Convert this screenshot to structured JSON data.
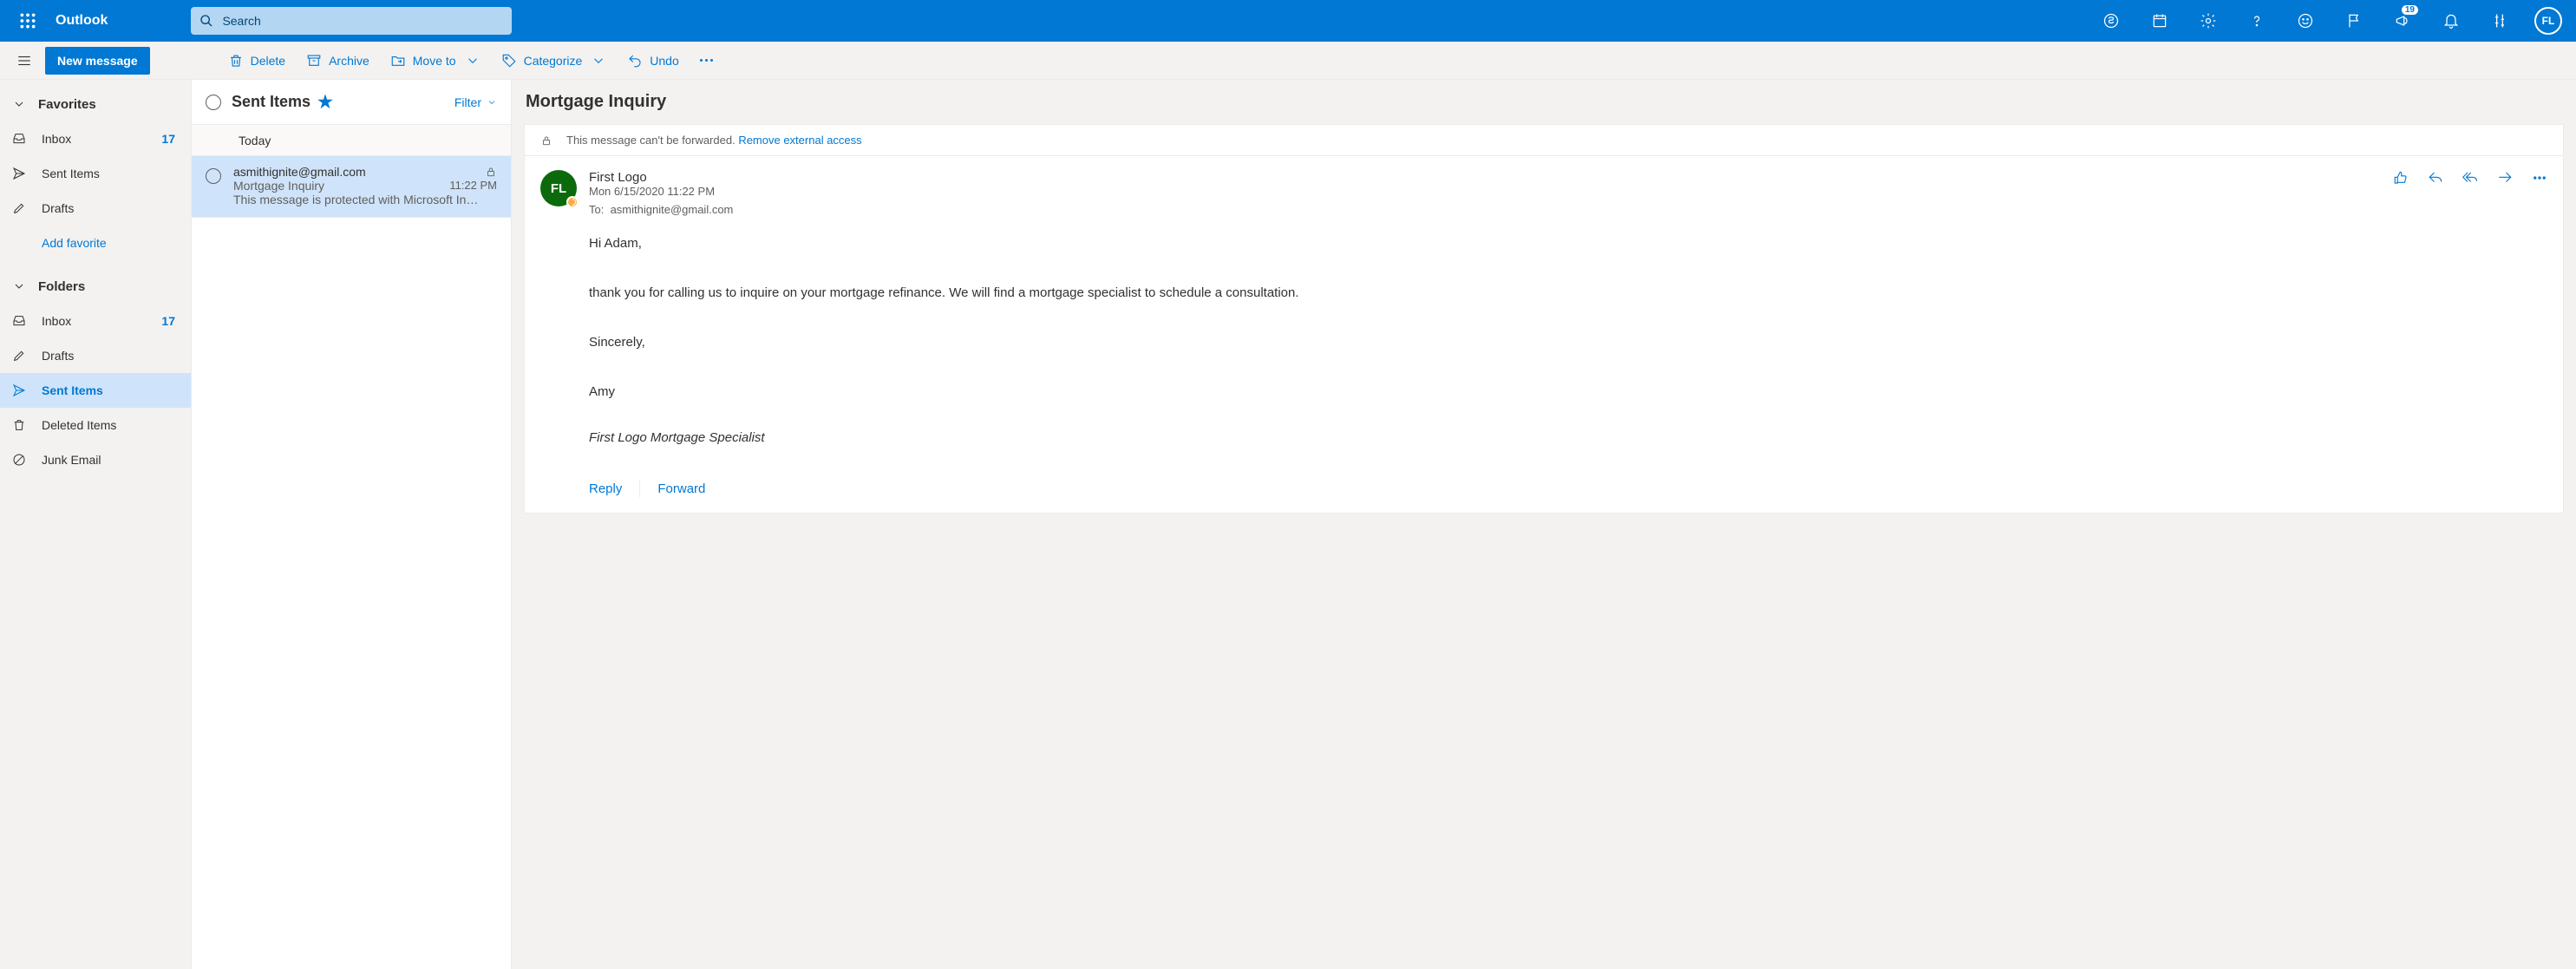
{
  "header": {
    "app": "Outlook",
    "search_placeholder": "Search",
    "notif_count": "19",
    "avatar_initials": "FL"
  },
  "toolbar": {
    "new_message": "New message",
    "delete": "Delete",
    "archive": "Archive",
    "move_to": "Move to",
    "categorize": "Categorize",
    "undo": "Undo"
  },
  "nav": {
    "favorites_label": "Favorites",
    "folders_label": "Folders",
    "add_favorite": "Add favorite",
    "fav": [
      {
        "label": "Inbox",
        "count": "17"
      },
      {
        "label": "Sent Items"
      },
      {
        "label": "Drafts"
      }
    ],
    "folders": [
      {
        "label": "Inbox",
        "count": "17"
      },
      {
        "label": "Drafts"
      },
      {
        "label": "Sent Items",
        "selected": true
      },
      {
        "label": "Deleted Items"
      },
      {
        "label": "Junk Email"
      }
    ]
  },
  "list": {
    "title": "Sent Items",
    "filter": "Filter",
    "group": "Today",
    "items": [
      {
        "from": "asmithignite@gmail.com",
        "subject": "Mortgage Inquiry",
        "preview": "This message is protected with Microsoft In…",
        "time": "11:22 PM",
        "locked": true,
        "selected": true
      }
    ]
  },
  "reader": {
    "subject": "Mortgage Inquiry",
    "banner_text": "This message can't be forwarded. ",
    "banner_link": "Remove external access",
    "sender_name": "First Logo",
    "sender_initials": "FL",
    "date": "Mon 6/15/2020 11:22 PM",
    "to_label": "To:",
    "to_value": "asmithignite@gmail.com",
    "body_greeting": "Hi Adam,",
    "body_p1": " thank you for calling us to inquire on your mortgage refinance.  We will find a mortgage specialist to schedule a consultation.",
    "body_closing": "Sincerely,",
    "body_name": "Amy",
    "signature": "First Logo Mortgage Specialist",
    "reply": "Reply",
    "forward": "Forward"
  }
}
